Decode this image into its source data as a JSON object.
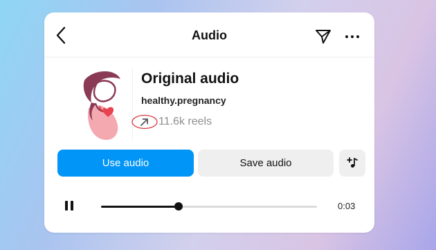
{
  "header": {
    "title": "Audio",
    "back_icon": "chevron-left-icon",
    "share_icon": "paper-plane-icon",
    "more_icon": "more-horizontal-icon"
  },
  "audio": {
    "title": "Original audio",
    "artist": "healthy.pregnancy",
    "reels_count": "11.6k reels",
    "cover_icon": "pregnant-woman-illustration",
    "reels_icon": "arrow-up-right-icon"
  },
  "actions": {
    "use_audio": "Use audio",
    "save_audio": "Save audio",
    "add_icon": "add-music-icon"
  },
  "player": {
    "time": "0:03",
    "progress": 0.36,
    "state": "playing",
    "pause_icon": "pause-icon"
  },
  "colors": {
    "primary": "#0095f6",
    "secondary_button": "#efefef",
    "annotation_circle": "#d8353a",
    "cover_maroon": "#8b3a55",
    "cover_pink": "#f3a0a8"
  }
}
